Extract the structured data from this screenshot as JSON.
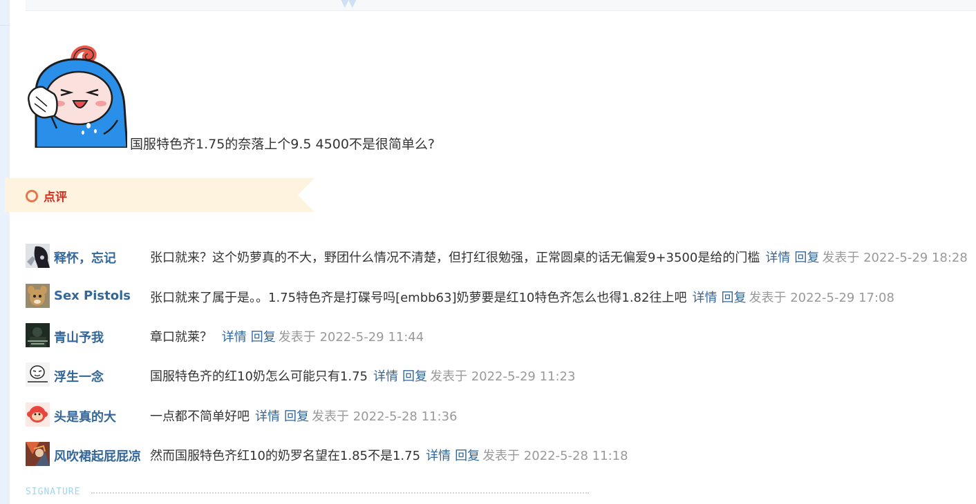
{
  "post": {
    "text": "国服特色齐1.75的奈落上个9.5 4500不是很简单么?"
  },
  "comment_section": {
    "title": "点评"
  },
  "comments": [
    {
      "user": "释怀，忘记",
      "text": "张口就来？这个奶萝真的不大，野团什么情况不清楚，但打红很勉强，正常圆桌的话无偏爱9+3500是给的门槛",
      "detail": "详情",
      "reply": "回复",
      "time": "发表于 2022-5-29 18:28"
    },
    {
      "user": "Sex Pistols",
      "text": "张口就来了属于是。。1.75特色齐是打碟号吗[embb63]奶萝要是红10特色齐怎么也得1.82往上吧",
      "detail": "详情",
      "reply": "回复",
      "time": "发表于 2022-5-29 17:08"
    },
    {
      "user": "青山予我",
      "text": "章口就莱？ ",
      "detail": "详情",
      "reply": "回复",
      "time": "发表于 2022-5-29 11:44"
    },
    {
      "user": "浮生一念",
      "text": "国服特色齐的红10奶怎么可能只有1.75",
      "detail": "详情",
      "reply": "回复",
      "time": "发表于 2022-5-29 11:23"
    },
    {
      "user": "头是真的大",
      "text": "一点都不简单好吧",
      "detail": "详情",
      "reply": "回复",
      "time": "发表于 2022-5-28 11:36"
    },
    {
      "user": "风吹裙起屁屁凉",
      "text": "然而国服特色齐红10的奶罗名望在1.85不是1.75",
      "detail": "详情",
      "reply": "回复",
      "time": "发表于 2022-5-28 11:18"
    }
  ],
  "signature": {
    "label": "SIGNATURE"
  },
  "colors": {
    "link": "#336699",
    "time": "#999999",
    "banner_bg": "#fef3de",
    "banner_title": "#d32a1e",
    "banner_icon": "#e8744b"
  },
  "icons": {
    "sticker": "blue-hooded-sweating-sticker",
    "comment": "circle-icon",
    "topbar": "double-chevron-icon"
  }
}
